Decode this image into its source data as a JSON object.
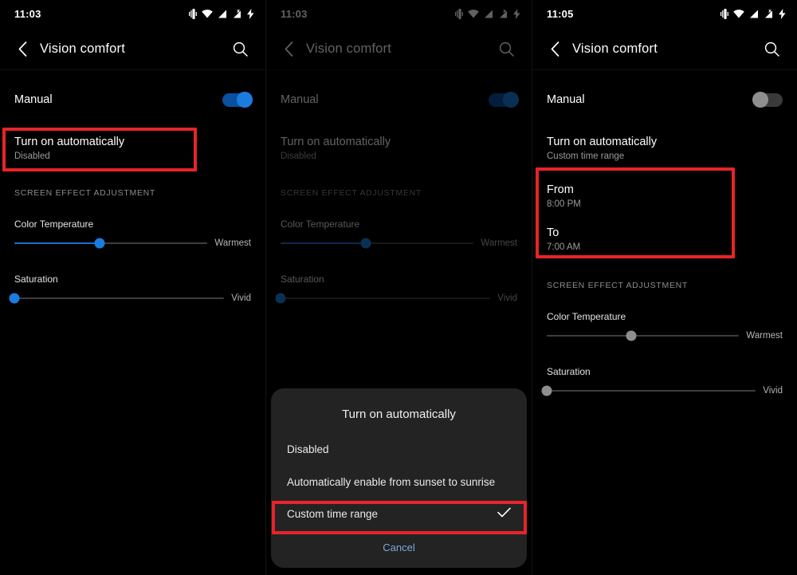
{
  "app": {
    "title": "Vision comfort",
    "back_icon": "back-arrow-icon",
    "search_icon": "search-icon"
  },
  "status_icons": [
    "vibrate-icon",
    "wifi-icon",
    "signal-icon",
    "signal-no-sim-icon",
    "charging-bolt-icon"
  ],
  "colors": {
    "accent": "#1b7ce0",
    "annotation": "#e8232a",
    "dialog_bg": "#232323",
    "screen_bg": "#000000",
    "link": "#7da7dd"
  },
  "panels": [
    {
      "id": "panel-default",
      "clock": "11:03",
      "manual": {
        "label": "Manual",
        "state": "on"
      },
      "auto": {
        "label": "Turn on automatically",
        "value": "Disabled"
      },
      "section_label": "SCREEN EFFECT ADJUSTMENT",
      "sliders": [
        {
          "label": "Color Temperature",
          "end_label": "Warmest",
          "percent": 44,
          "enabled": true
        },
        {
          "label": "Saturation",
          "end_label": "Vivid",
          "percent": 0,
          "enabled": true
        }
      ],
      "highlight": "turn-on-automatically-row"
    },
    {
      "id": "panel-dialog",
      "clock": "11:03",
      "manual": {
        "label": "Manual",
        "state": "on"
      },
      "auto": {
        "label": "Turn on automatically",
        "value": "Disabled"
      },
      "section_label": "SCREEN EFFECT ADJUSTMENT",
      "sliders": [
        {
          "label": "Color Temperature",
          "end_label": "Warmest",
          "percent": 44,
          "enabled": true
        },
        {
          "label": "Saturation",
          "end_label": "Vivid",
          "percent": 0,
          "enabled": true
        }
      ],
      "dialog": {
        "title": "Turn on automatically",
        "options": [
          {
            "label": "Disabled",
            "selected": false
          },
          {
            "label": "Automatically enable from sunset to sunrise",
            "selected": false
          },
          {
            "label": "Custom time range",
            "selected": true
          }
        ],
        "check_icon": "check-icon",
        "cancel": "Cancel"
      },
      "highlight": "custom-time-range-option"
    },
    {
      "id": "panel-custom-range",
      "clock": "11:05",
      "manual": {
        "label": "Manual",
        "state": "off"
      },
      "auto": {
        "label": "Turn on automatically",
        "value": "Custom time range"
      },
      "time_range": [
        {
          "label": "From",
          "value": "8:00 PM"
        },
        {
          "label": "To",
          "value": "7:00 AM"
        }
      ],
      "section_label": "SCREEN EFFECT ADJUSTMENT",
      "sliders": [
        {
          "label": "Color Temperature",
          "end_label": "Warmest",
          "percent": 44,
          "enabled": false
        },
        {
          "label": "Saturation",
          "end_label": "Vivid",
          "percent": 0,
          "enabled": false
        }
      ],
      "highlight": "time-range-rows"
    }
  ]
}
